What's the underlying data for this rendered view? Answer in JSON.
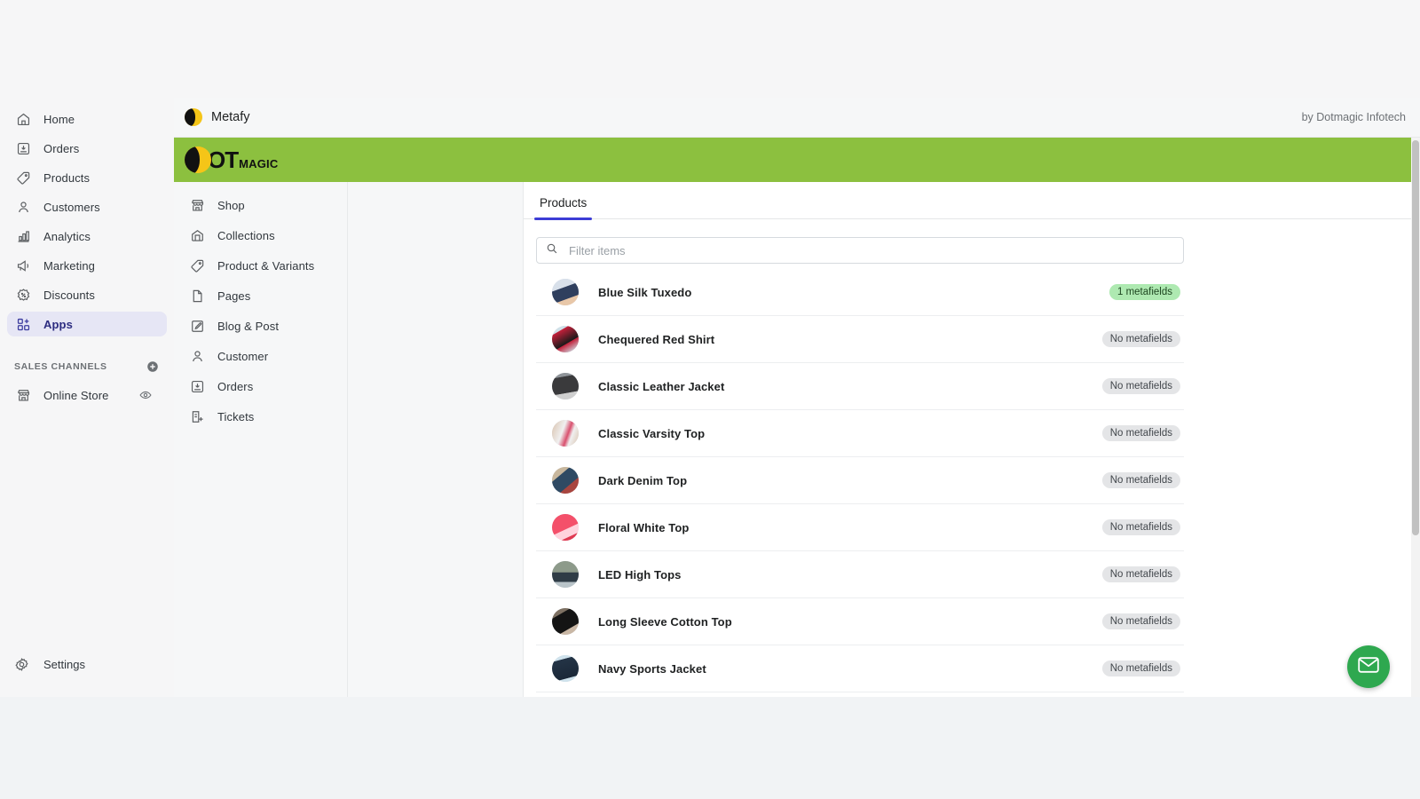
{
  "sidebar": {
    "items": [
      {
        "label": "Home",
        "icon": "home-icon",
        "active": false
      },
      {
        "label": "Orders",
        "icon": "orders-icon",
        "active": false
      },
      {
        "label": "Products",
        "icon": "products-tag-icon",
        "active": false
      },
      {
        "label": "Customers",
        "icon": "customers-icon",
        "active": false
      },
      {
        "label": "Analytics",
        "icon": "analytics-bar-icon",
        "active": false
      },
      {
        "label": "Marketing",
        "icon": "marketing-megaphone-icon",
        "active": false
      },
      {
        "label": "Discounts",
        "icon": "discounts-badge-icon",
        "active": false
      },
      {
        "label": "Apps",
        "icon": "apps-grid-icon",
        "active": true
      }
    ],
    "sales_channels": {
      "title": "SALES CHANNELS",
      "add_icon": "plus-circle-icon",
      "items": [
        {
          "label": "Online Store",
          "icon": "storefront-icon",
          "trailing_icon": "eye-icon"
        }
      ]
    },
    "settings": {
      "label": "Settings",
      "icon": "gear-icon"
    }
  },
  "app": {
    "title": "Metafy",
    "logo_icon": "metafy-moon-logo",
    "byline": "by Dotmagic Infotech",
    "banner": {
      "logo_icon": "dotmagic-moon-logo",
      "logo_primary": "OT",
      "logo_secondary": "MAGIC",
      "background_color": "#8cc03f"
    },
    "nav": [
      {
        "label": "Shop",
        "icon": "storefront-icon"
      },
      {
        "label": "Collections",
        "icon": "collections-icon"
      },
      {
        "label": "Product & Variants",
        "icon": "products-tag-icon"
      },
      {
        "label": "Pages",
        "icon": "page-icon"
      },
      {
        "label": "Blog & Post",
        "icon": "blog-pencil-icon"
      },
      {
        "label": "Customer",
        "icon": "customers-icon"
      },
      {
        "label": "Orders",
        "icon": "orders-icon"
      },
      {
        "label": "Tickets",
        "icon": "ticket-add-icon"
      }
    ],
    "tabs": [
      {
        "label": "Products",
        "active": true
      }
    ],
    "search": {
      "placeholder": "Filter items",
      "value": "",
      "icon": "search-icon"
    },
    "products": [
      {
        "name": "Blue Silk Tuxedo",
        "badge": "1 metafields",
        "badge_style": "green",
        "thumb_colors": [
          "#d8e0ea",
          "#2f3f5e",
          "#e8c7a8"
        ]
      },
      {
        "name": "Chequered Red Shirt",
        "badge": "No metafields",
        "badge_style": "gray",
        "thumb_colors": [
          "#cfe0e8",
          "#c2203a",
          "#1a1a1a"
        ]
      },
      {
        "name": "Classic Leather Jacket",
        "badge": "No metafields",
        "badge_style": "gray",
        "thumb_colors": [
          "#8f9499",
          "#3a3a3c",
          "#cfcfcf"
        ]
      },
      {
        "name": "Classic Varsity Top",
        "badge": "No metafields",
        "badge_style": "gray",
        "thumb_colors": [
          "#d9c2ad",
          "#f0f0f0",
          "#d94f6e"
        ]
      },
      {
        "name": "Dark Denim Top",
        "badge": "No metafields",
        "badge_style": "gray",
        "thumb_colors": [
          "#c8b79d",
          "#2f4a63",
          "#a8453f"
        ]
      },
      {
        "name": "Floral White Top",
        "badge": "No metafields",
        "badge_style": "gray",
        "thumb_colors": [
          "#f4506a",
          "#ffd3dd",
          "#e03a52"
        ]
      },
      {
        "name": "LED High Tops",
        "badge": "No metafields",
        "badge_style": "gray",
        "thumb_colors": [
          "#8d9a8a",
          "#2f3c46",
          "#b9c4c9"
        ]
      },
      {
        "name": "Long Sleeve Cotton Top",
        "badge": "No metafields",
        "badge_style": "gray",
        "thumb_colors": [
          "#7e7163",
          "#141414",
          "#c9b7a5"
        ]
      },
      {
        "name": "Navy Sports Jacket",
        "badge": "No metafields",
        "badge_style": "gray",
        "thumb_colors": [
          "#cfe2ec",
          "#243446",
          "#1b2838"
        ]
      }
    ],
    "fab": {
      "icon": "envelope-icon",
      "color": "#2ea84f"
    },
    "scrollbar": {
      "name": "vertical-scrollbar"
    }
  }
}
